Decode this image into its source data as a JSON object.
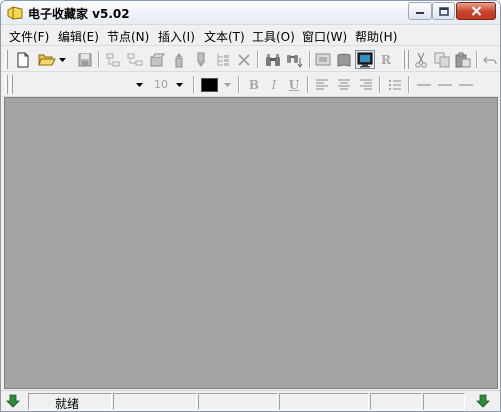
{
  "window": {
    "title": "电子收藏家 v5.02"
  },
  "menu": [
    {
      "label": "文件(F)"
    },
    {
      "label": "编辑(E)"
    },
    {
      "label": "节点(N)"
    },
    {
      "label": "插入(I)"
    },
    {
      "label": "文本(T)"
    },
    {
      "label": "工具(O)"
    },
    {
      "label": "窗口(W)"
    },
    {
      "label": "帮助(H)"
    }
  ],
  "format_toolbar": {
    "font_name": "",
    "font_size": "10",
    "text_color": "#000000",
    "bold_label": "B",
    "italic_label": "I",
    "underline_label": "U"
  },
  "main_toolbar": {
    "ruby_label": "R"
  },
  "status": {
    "text": "就绪"
  },
  "colors": {
    "client_bg": "#a4a4a4",
    "close_button": "#c8432a",
    "status_arrow": "#2e8b3a"
  }
}
